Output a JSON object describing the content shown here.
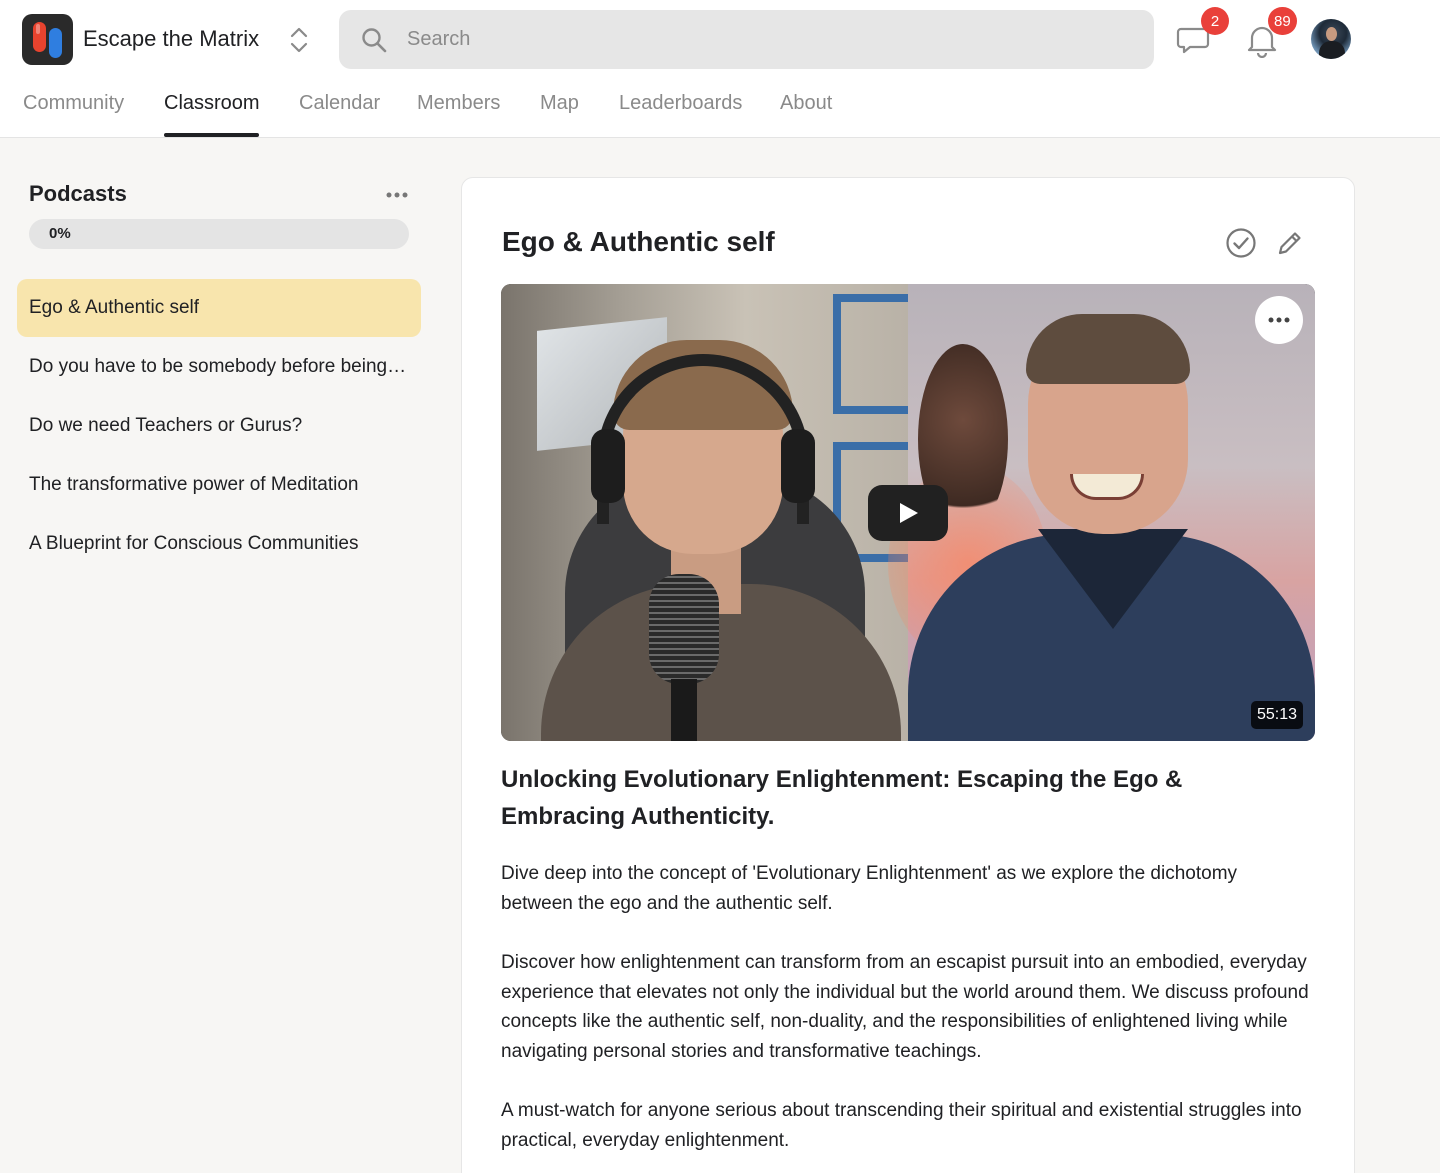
{
  "app": {
    "title": "Escape the Matrix"
  },
  "search": {
    "placeholder": "Search"
  },
  "header": {
    "chat_badge": "2",
    "notifications_badge": "89"
  },
  "tabs": [
    {
      "label": "Community"
    },
    {
      "label": "Classroom",
      "active": true
    },
    {
      "label": "Calendar"
    },
    {
      "label": "Members"
    },
    {
      "label": "Map"
    },
    {
      "label": "Leaderboards"
    },
    {
      "label": "About"
    }
  ],
  "sidebar": {
    "title": "Podcasts",
    "progress_label": "0%",
    "progress_value": 0,
    "lessons": [
      {
        "label": "Ego & Authentic self",
        "active": true
      },
      {
        "label": "Do you have to be somebody before being nobody?"
      },
      {
        "label": "Do we need Teachers or Gurus?"
      },
      {
        "label": "The transformative power of Meditation"
      },
      {
        "label": "A Blueprint for Conscious Communities"
      }
    ]
  },
  "lesson": {
    "title": "Ego & Authentic self",
    "video_duration": "55:13",
    "heading": "Unlocking Evolutionary Enlightenment: Escaping the Ego & Embracing Authenticity.",
    "paragraphs": [
      "Dive deep into the concept of 'Evolutionary Enlightenment' as we explore the dichotomy between the ego and the authentic self.",
      "Discover how enlightenment can transform from an escapist pursuit into an embodied, everyday experience that elevates not only the individual but the world around them. We discuss profound concepts like the authentic self, non-duality, and the responsibilities of enlightened living while navigating personal stories and transformative teachings.",
      "A must-watch for anyone serious about transcending their spiritual and existential struggles into practical, everyday enlightenment."
    ]
  },
  "colors": {
    "accent_active_lesson": "#f8e5ad",
    "badge_red": "#e9403a",
    "text_primary": "#202124",
    "text_muted": "#8a8a8a"
  }
}
